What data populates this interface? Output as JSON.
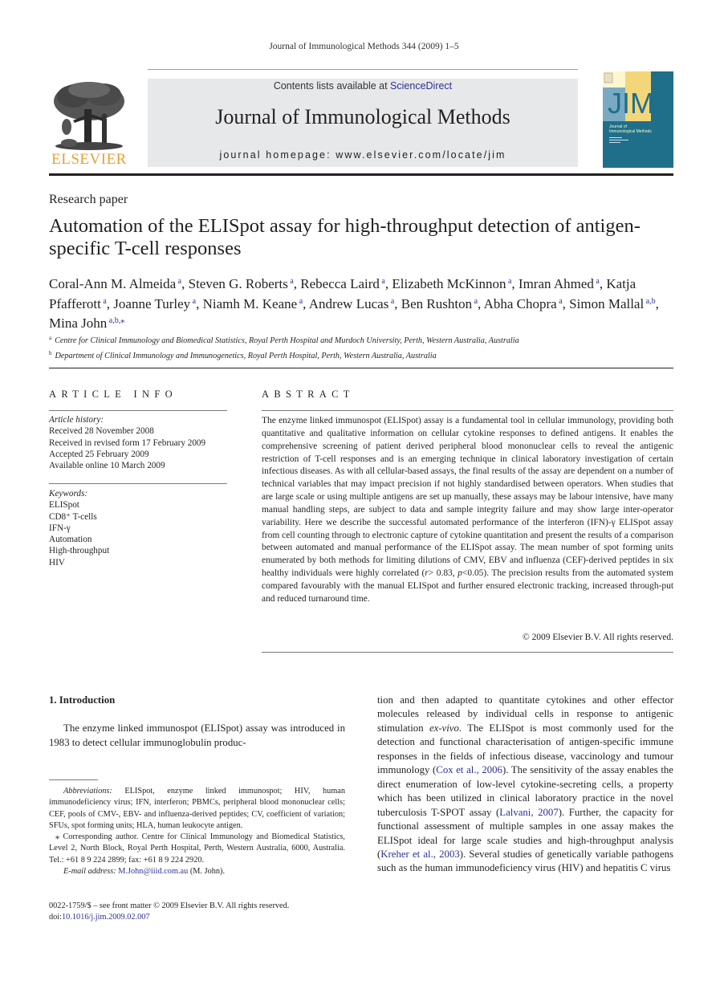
{
  "running_head": "Journal of Immunological Methods 344 (2009) 1–5",
  "publisher": {
    "logo_word": "ELSEVIER",
    "logo_color": "#e9a036"
  },
  "masthead": {
    "contents_prefix": "Contents lists available at ",
    "contents_link": "ScienceDirect",
    "journal_name": "Journal of Immunological Methods",
    "homepage": "journal homepage: www.elsevier.com/locate/jim",
    "background": "#e7e8e9"
  },
  "cover": {
    "acronym": "JIM",
    "subtitle_line1": "Journal of",
    "subtitle_line2": "Immunological Methods",
    "colors": {
      "blue": "#1f6f8b",
      "light_blue": "#7aaac2",
      "yellow": "#f4d67a",
      "cream": "#fdf6cf"
    }
  },
  "article": {
    "type": "Research paper",
    "title": "Automation of the ELISpot assay for high-throughput detection of antigen-specific T-cell responses",
    "authors": [
      {
        "name": "Coral-Ann M. Almeida",
        "aff": "a",
        "sep": ", "
      },
      {
        "name": "Steven G. Roberts",
        "aff": "a",
        "sep": ", "
      },
      {
        "name": "Rebecca Laird",
        "aff": "a",
        "sep": ", "
      },
      {
        "name": "Elizabeth McKinnon",
        "aff": "a",
        "sep": ", "
      },
      {
        "name": "Imran Ahmed",
        "aff": "a",
        "sep": ", "
      },
      {
        "name": "Katja Pfafferott",
        "aff": "a",
        "sep": ", "
      },
      {
        "name": "Joanne Turley",
        "aff": "a",
        "sep": ", "
      },
      {
        "name": "Niamh M. Keane",
        "aff": "a",
        "sep": ", "
      },
      {
        "name": "Andrew Lucas",
        "aff": "a",
        "sep": ", "
      },
      {
        "name": "Ben Rushton",
        "aff": "a",
        "sep": ", "
      },
      {
        "name": "Abha Chopra",
        "aff": "a",
        "sep": ", "
      },
      {
        "name": "Simon Mallal",
        "aff": "a,b",
        "sep": ", "
      },
      {
        "name": "Mina John",
        "aff": "a,b,⁎",
        "sep": ""
      }
    ],
    "affiliations": [
      {
        "mark": "a",
        "text": "Centre for Clinical Immunology and Biomedical Statistics, Royal Perth Hospital and Murdoch University, Perth, Western Australia, Australia"
      },
      {
        "mark": "b",
        "text": "Department of Clinical Immunology and Immunogenetics, Royal Perth Hospital, Perth, Western Australia, Australia"
      }
    ]
  },
  "article_info": {
    "heading": "ARTICLE INFO",
    "history_label": "Article history:",
    "history": [
      "Received 28 November 2008",
      "Received in revised form 17 February 2009",
      "Accepted 25 February 2009",
      "Available online 10 March 2009"
    ],
    "keywords_label": "Keywords:",
    "keywords": [
      "ELISpot",
      "CD8⁺ T-cells",
      "IFN-γ",
      "Automation",
      "High-throughput",
      "HIV"
    ]
  },
  "abstract": {
    "heading": "ABSTRACT",
    "part1": "The enzyme linked immunospot (ELISpot) assay is a fundamental tool in cellular immunology, providing both quantitative and qualitative information on cellular cytokine responses to defined antigens. It enables the comprehensive screening of patient derived peripheral blood mononuclear cells to reveal the antigenic restriction of T-cell responses and is an emerging technique in clinical laboratory investigation of certain infectious diseases. As with all cellular-based assays, the final results of the assay are dependent on a number of technical variables that may impact precision if not highly standardised between operators. When studies that are large scale or using multiple antigens are set up manually, these assays may be labour intensive, have many manual handling steps, are subject to data and sample integrity failure and may show large inter-operator variability. Here we describe the successful automated performance of the interferon (IFN)-γ ELISpot assay from cell counting through to electronic capture of cytokine quantitation and present the results of a comparison between automated and manual performance of the ELISpot assay. The mean number of spot forming units enumerated by both methods for limiting dilutions of CMV, EBV and influenza (CEF)-derived peptides in six healthy individuals were highly correlated (",
    "r_symbol": "r",
    "r_value": "> 0.83, ",
    "p_symbol": "p",
    "p_value": "<0.05",
    "part2": "). The precision results from the automated system compared favourably with the manual ELISpot and further ensured electronic tracking, increased through-put and reduced turnaround time.",
    "copyright": "© 2009 Elsevier B.V. All rights reserved."
  },
  "introduction": {
    "heading": "1. Introduction",
    "para_left": "The enzyme linked immunospot (ELISpot) assay was introduced in 1983 to detect cellular immunoglobulin produc-",
    "right": {
      "t1": "tion and then adapted to quantitate cytokines and other effector molecules released by individual cells in response to antigenic stimulation ",
      "t1_italic": "ex-vivo",
      "t2": ". The ELISpot is most commonly used for the detection and functional characterisation of antigen-specific immune responses in the fields of infectious disease, vaccinology and tumour immunology (",
      "ref1": "Cox et al., 2006",
      "t3": "). The sensitivity of the assay enables the direct enumeration of low-level cytokine-secreting cells, a property which has been utilized in clinical laboratory practice in the novel tuberculosis T-SPOT assay (",
      "ref2": "Lalvani, 2007",
      "t4": "). Further, the capacity for functional assessment of multiple samples in one assay makes the ELISpot ideal for large scale studies and high-throughput analysis (",
      "ref3": "Kreher et al., 2003",
      "t5": "). Several studies of genetically variable pathogens such as the human immunodeficiency virus (HIV) and hepatitis C virus"
    }
  },
  "footnotes": {
    "abbrev_label": "Abbreviations:",
    "abbrev_text": " ELISpot, enzyme linked immunospot; HIV, human immunodeficiency virus; IFN, interferon; PBMCs, peripheral blood mononuclear cells; CEF, pools of CMV-, EBV- and influenza-derived peptides; CV, coefficient of variation; SFUs, spot forming units; HLA, human leukocyte antigen.",
    "corresponding": "⁎ Corresponding author. Centre for Clinical Immunology and Biomedical Statistics, Level 2, North Block, Royal Perth Hospital, Perth, Western Australia, 6000, Australia. Tel.: +61 8 9 224 2899; fax: +61 8 9 224 2920.",
    "email_label": "E-mail address:",
    "email": "M.John@iiid.com.au",
    "email_suffix": " (M. John)."
  },
  "front_matter": {
    "issn_line": "0022-1759/$ – see front matter © 2009 Elsevier B.V. All rights reserved.",
    "doi_label": "doi:",
    "doi": "10.1016/j.jim.2009.02.007"
  },
  "colors": {
    "link": "#2e3192",
    "text": "#231f20"
  }
}
